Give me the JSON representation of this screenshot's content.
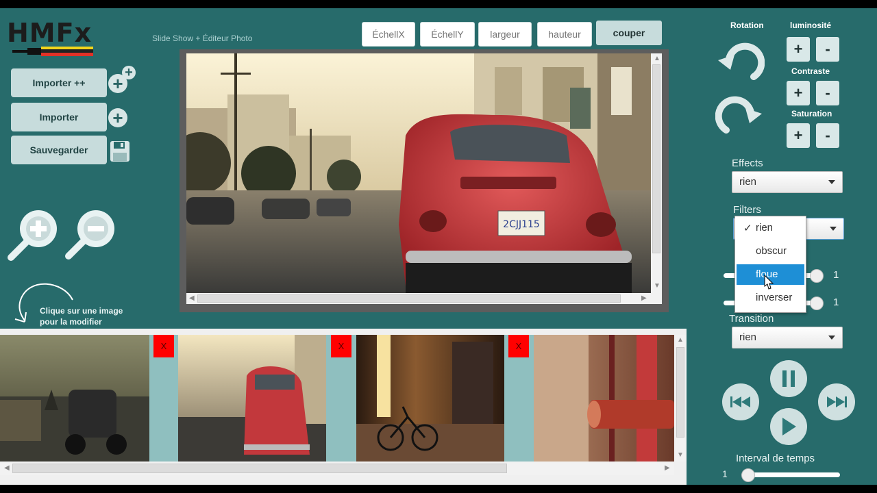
{
  "app": {
    "logo": "HMFx",
    "subtitle": "Slide Show + Éditeur Photo"
  },
  "left": {
    "import_plus": "Importer ++",
    "import": "Importer",
    "save": "Sauvegarder",
    "hint_line1": "Clique sur une image",
    "hint_line2": "pour la modifier"
  },
  "toolbar": {
    "scale_x_placeholder": "ÉchellX",
    "scale_y_placeholder": "ÉchellY",
    "width_placeholder": "largeur",
    "height_placeholder": "hauteur",
    "cut": "couper"
  },
  "viewer": {
    "plate": "2CJJ115"
  },
  "thumbnails": {
    "delete_label": "X"
  },
  "right": {
    "rotation": "Rotation",
    "brightness": "luminosité",
    "contrast": "Contraste",
    "saturation": "Saturation",
    "plus": "+",
    "minus": "-",
    "effects_label": "Effects",
    "effects_value": "rien",
    "filters_label": "Filters",
    "filters_options": [
      "rien",
      "obscur",
      "floue",
      "inverser"
    ],
    "filters_checkmark": "✓",
    "slider1_value": "1",
    "slider2_value": "1",
    "transition_label": "Transition",
    "transition_value": "rien",
    "interval_label": "Interval de temps",
    "interval_value": "1"
  },
  "colors": {
    "background": "#276b6b",
    "accent_highlight": "#1e8fd6",
    "delete_red": "#ff0000"
  }
}
